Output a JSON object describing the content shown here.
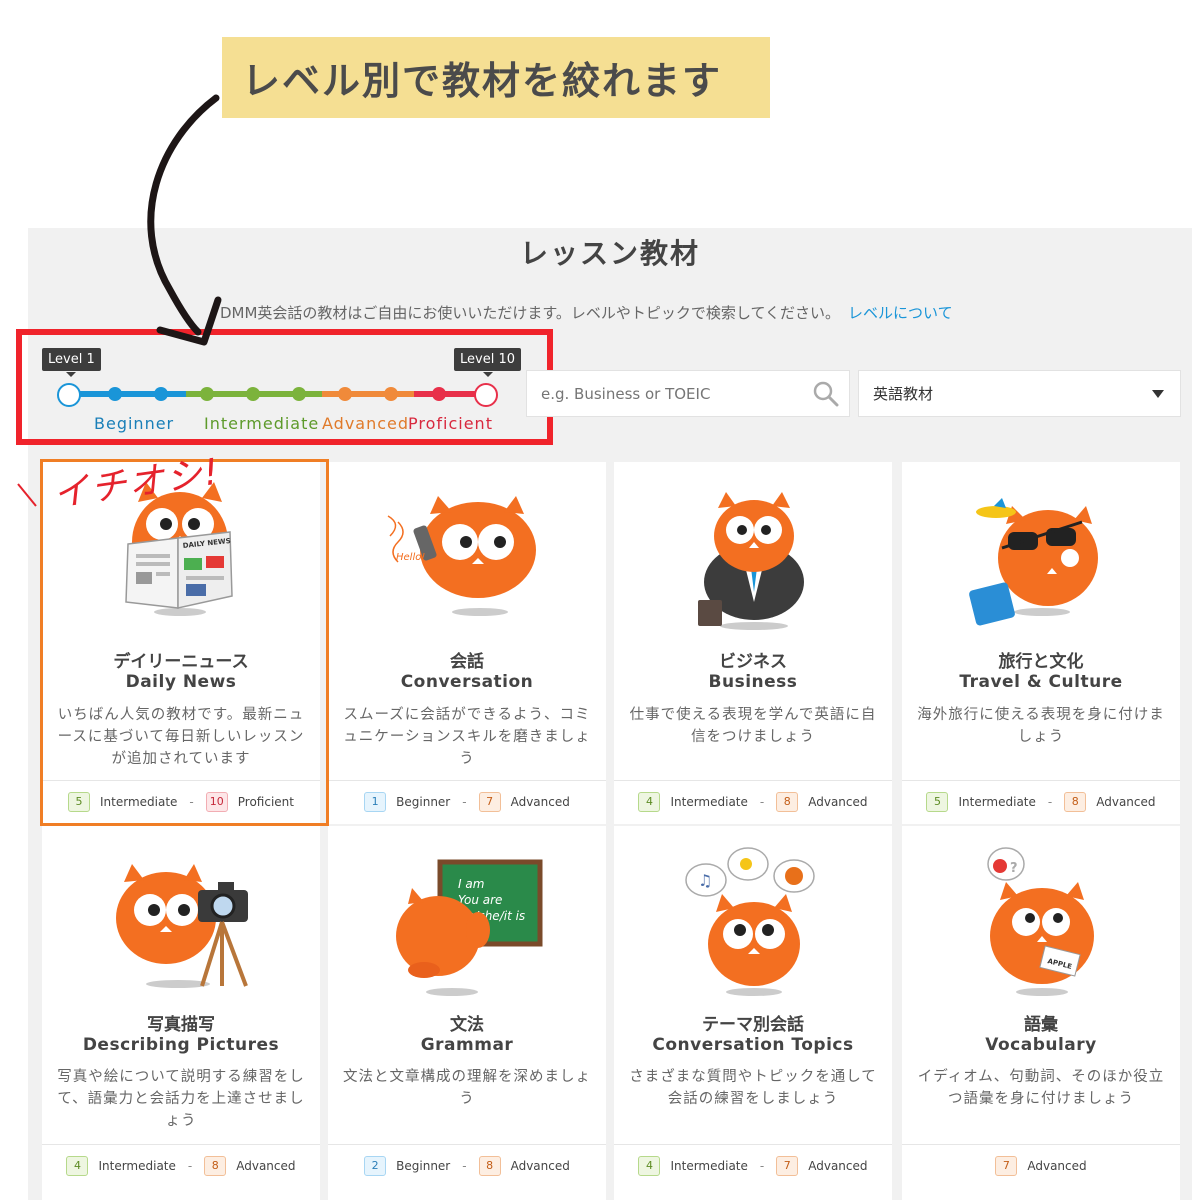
{
  "banner": {
    "headline": "レベル別で教材を絞れます"
  },
  "page": {
    "title": "レッスン教材",
    "subtitle": "DMM英会話の教材はご自由にお使いいただけます。レベルやトピックで検索してください。",
    "subtitle_link": "レベルについて"
  },
  "slider": {
    "min_label": "Level 1",
    "max_label": "Level 10",
    "bands": [
      {
        "label": "Beginner",
        "color": "#1a95d8"
      },
      {
        "label": "Intermediate",
        "color": "#7cb33c"
      },
      {
        "label": "Advanced",
        "color": "#f08a3a"
      },
      {
        "label": "Proficient",
        "color": "#e8304a"
      }
    ],
    "selected_min": 1,
    "selected_max": 10
  },
  "search": {
    "placeholder": "e.g. Business or TOEIC",
    "icon": "search-icon"
  },
  "filter": {
    "value": "英語教材",
    "icon": "chevron-down-icon"
  },
  "annotation": {
    "pick": "イチオシ!"
  },
  "cards": [
    {
      "jp": "デイリーニュース",
      "en": "Daily News",
      "desc": "いちばん人気の教材です。最新ニュースに基づいて毎日新しいレッスンが追加されています",
      "illus": "owl-reading-newspaper",
      "from": {
        "num": "5",
        "label": "Intermediate",
        "tone": "green"
      },
      "to": {
        "num": "10",
        "label": "Proficient",
        "tone": "red"
      }
    },
    {
      "jp": "会話",
      "en": "Conversation",
      "desc": "スムーズに会話ができるよう、コミュニケーションスキルを磨きましょう",
      "illus": "owl-on-phone",
      "from": {
        "num": "1",
        "label": "Beginner",
        "tone": "blue"
      },
      "to": {
        "num": "7",
        "label": "Advanced",
        "tone": "orange"
      }
    },
    {
      "jp": "ビジネス",
      "en": "Business",
      "desc": "仕事で使える表現を学んで英語に自信をつけましょう",
      "illus": "owl-in-suit",
      "from": {
        "num": "4",
        "label": "Intermediate",
        "tone": "green"
      },
      "to": {
        "num": "8",
        "label": "Advanced",
        "tone": "orange"
      }
    },
    {
      "jp": "旅行と文化",
      "en": "Travel & Culture",
      "desc": "海外旅行に使える表現を身に付けましょう",
      "illus": "owl-traveling",
      "from": {
        "num": "5",
        "label": "Intermediate",
        "tone": "green"
      },
      "to": {
        "num": "8",
        "label": "Advanced",
        "tone": "orange"
      }
    },
    {
      "jp": "写真描写",
      "en": "Describing Pictures",
      "desc": "写真や絵について説明する練習をして、語彙力と会話力を上達させましょう",
      "illus": "owl-with-camera",
      "from": {
        "num": "4",
        "label": "Intermediate",
        "tone": "green"
      },
      "to": {
        "num": "8",
        "label": "Advanced",
        "tone": "orange"
      }
    },
    {
      "jp": "文法",
      "en": "Grammar",
      "desc": "文法と文章構成の理解を深めましょう",
      "illus": "owl-at-blackboard",
      "board": [
        "I am",
        "You are",
        "He/she/it is"
      ],
      "from": {
        "num": "2",
        "label": "Beginner",
        "tone": "blue"
      },
      "to": {
        "num": "8",
        "label": "Advanced",
        "tone": "orange"
      }
    },
    {
      "jp": "テーマ別会話",
      "en": "Conversation Topics",
      "desc": "さまざまな質問やトピックを通して会話の練習をしましょう",
      "illus": "owl-thinking-topics",
      "from": {
        "num": "4",
        "label": "Intermediate",
        "tone": "green"
      },
      "to": {
        "num": "7",
        "label": "Advanced",
        "tone": "orange"
      }
    },
    {
      "jp": "語彙",
      "en": "Vocabulary",
      "desc": "イディオム、句動詞、そのほか役立つ語彙を身に付けましょう",
      "illus": "owl-with-apple-card",
      "card_word": "APPLE",
      "from": null,
      "to": {
        "num": "7",
        "label": "Advanced",
        "tone": "orange"
      }
    }
  ],
  "newspaper_title": "DAILY NEWS",
  "hello": "Hello!"
}
